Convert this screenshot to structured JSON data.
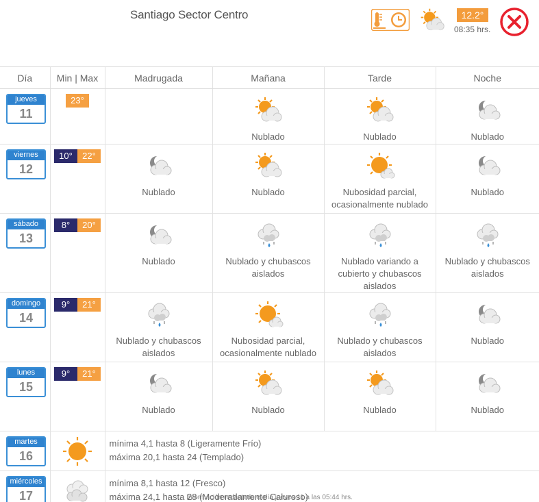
{
  "header": {
    "station": "Santiago Sector Centro",
    "current_temp": "12.2°",
    "current_time": "08:35 hrs.",
    "current_icon": "sun-cloud-icon",
    "thermo_icon": "thermometer-clock-icon",
    "close_icon": "close-icon",
    "accent": "#f39c3c",
    "close_color": "#e8212e"
  },
  "table": {
    "columns": [
      "Día",
      "Min | Max",
      "Madrugada",
      "Mañana",
      "Tarde",
      "Noche"
    ],
    "days": [
      {
        "day": "jueves",
        "num": "11",
        "min": "",
        "max": "23°",
        "periods": [
          {
            "icon": "",
            "desc": ""
          },
          {
            "icon": "sun-cloud-icon",
            "desc": "Nublado"
          },
          {
            "icon": "sun-cloud-icon",
            "desc": "Nublado"
          },
          {
            "icon": "moon-cloud-icon",
            "desc": "Nublado"
          }
        ]
      },
      {
        "day": "viernes",
        "num": "12",
        "min": "10°",
        "max": "22°",
        "periods": [
          {
            "icon": "moon-cloud-icon",
            "desc": "Nublado"
          },
          {
            "icon": "sun-cloud-icon",
            "desc": "Nublado"
          },
          {
            "icon": "sun-small-cloud-icon",
            "desc": "Nubosidad parcial, ocasionalmente nublado"
          },
          {
            "icon": "moon-cloud-icon",
            "desc": "Nublado"
          }
        ]
      },
      {
        "day": "sábado",
        "num": "13",
        "min": "8°",
        "max": "20°",
        "periods": [
          {
            "icon": "moon-cloud-icon",
            "desc": "Nublado"
          },
          {
            "icon": "cloud-rain-icon",
            "desc": "Nublado y chubascos aislados"
          },
          {
            "icon": "cloud-rain-icon",
            "desc": "Nublado variando a cubierto y chubascos aislados"
          },
          {
            "icon": "cloud-rain-icon",
            "desc": "Nublado y chubascos aislados"
          }
        ]
      },
      {
        "day": "domingo",
        "num": "14",
        "min": "9°",
        "max": "21°",
        "periods": [
          {
            "icon": "cloud-rain-icon",
            "desc": "Nublado y chubascos aislados"
          },
          {
            "icon": "sun-small-cloud-icon",
            "desc": "Nubosidad parcial, ocasionalmente nublado"
          },
          {
            "icon": "cloud-rain-icon",
            "desc": "Nublado y chubascos aislados"
          },
          {
            "icon": "moon-cloud-icon",
            "desc": "Nublado"
          }
        ]
      },
      {
        "day": "lunes",
        "num": "15",
        "min": "9°",
        "max": "21°",
        "periods": [
          {
            "icon": "moon-cloud-icon",
            "desc": "Nublado"
          },
          {
            "icon": "sun-cloud-icon",
            "desc": "Nublado"
          },
          {
            "icon": "sun-cloud-icon",
            "desc": "Nublado"
          },
          {
            "icon": "moon-cloud-icon",
            "desc": "Nublado"
          }
        ]
      }
    ],
    "summary_days": [
      {
        "day": "martes",
        "num": "16",
        "icon": "sun-icon",
        "line1": "mínima 4,1 hasta 8 (Ligeramente Frío)",
        "line2": "máxima 20,1 hasta 24 (Templado)"
      },
      {
        "day": "miércoles",
        "num": "17",
        "icon": "clouds-icon",
        "line1": "mínima 8,1 hasta 12 (Fresco)",
        "line2": "máxima 24,1 hasta 28 (Moderadamente Caluroso)"
      }
    ]
  },
  "footer": "Información redactada el día jueves 11 a las 05:44 hrs."
}
